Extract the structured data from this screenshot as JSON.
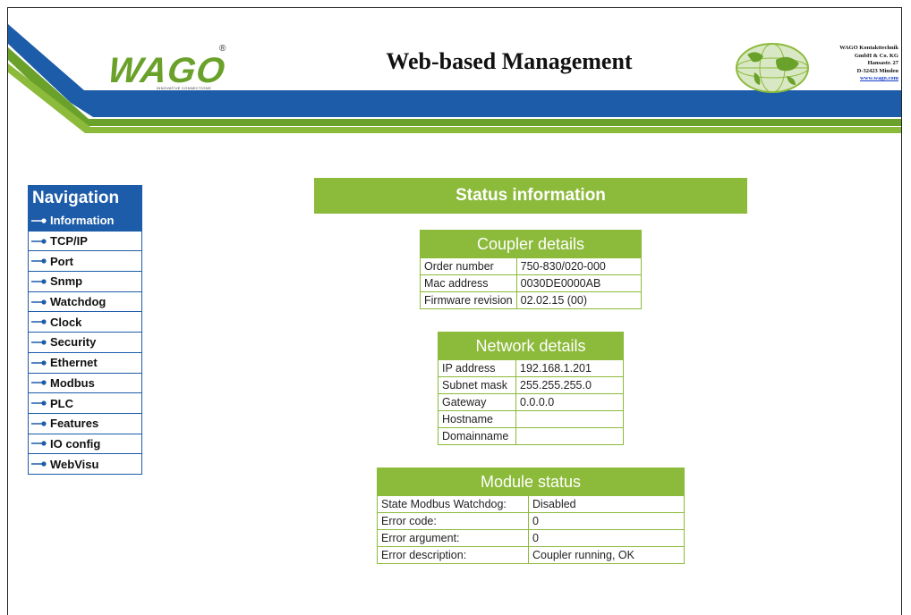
{
  "header": {
    "logo_text": "WAGO",
    "logo_registered": "®",
    "logo_tagline": "INNOVATIVE CONNECTIONS",
    "title": "Web-based Management",
    "company": [
      "WAGO Kontakttechnik",
      "GmbH & Co. KG",
      "Hansastr. 27",
      "D-32423 Minden"
    ],
    "company_url": "www.wago.com",
    "colors": {
      "blue": "#1c5ca9",
      "green": "#6aa12b"
    }
  },
  "nav": {
    "title": "Navigation",
    "items": [
      {
        "label": "Information",
        "active": true
      },
      {
        "label": "TCP/IP"
      },
      {
        "label": "Port"
      },
      {
        "label": "Snmp"
      },
      {
        "label": "Watchdog"
      },
      {
        "label": "Clock"
      },
      {
        "label": "Security"
      },
      {
        "label": "Ethernet"
      },
      {
        "label": "Modbus"
      },
      {
        "label": "PLC"
      },
      {
        "label": "Features"
      },
      {
        "label": "IO config"
      },
      {
        "label": "WebVisu"
      }
    ]
  },
  "main": {
    "title": "Status information",
    "coupler": {
      "title": "Coupler details",
      "rows": [
        [
          "Order number",
          "750-830/020-000"
        ],
        [
          "Mac address",
          "0030DE0000AB"
        ],
        [
          "Firmware revision",
          "02.02.15 (00)"
        ]
      ]
    },
    "network": {
      "title": "Network details",
      "rows": [
        [
          "IP address",
          "192.168.1.201"
        ],
        [
          "Subnet mask",
          "255.255.255.0"
        ],
        [
          "Gateway",
          "0.0.0.0"
        ],
        [
          "Hostname",
          ""
        ],
        [
          "Domainname",
          ""
        ]
      ]
    },
    "module": {
      "title": "Module status",
      "rows": [
        [
          "State Modbus Watchdog:",
          "Disabled"
        ],
        [
          "Error code:",
          "0"
        ],
        [
          "Error argument:",
          "0"
        ],
        [
          "Error description:",
          "Coupler running, OK"
        ]
      ]
    }
  }
}
